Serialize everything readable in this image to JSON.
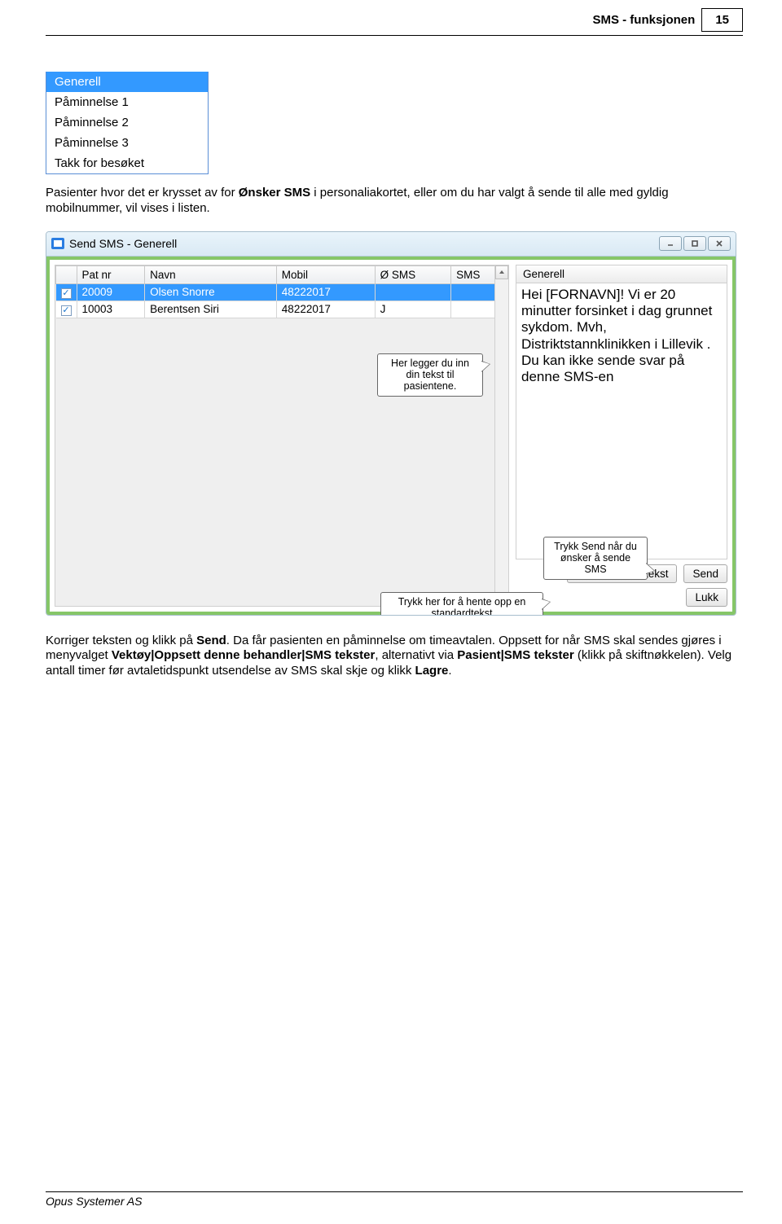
{
  "header": {
    "title": "SMS - funksjonen",
    "page": "15"
  },
  "dropdown": {
    "items": [
      "Generell",
      "Påminnelse 1",
      "Påminnelse 2",
      "Påminnelse 3",
      "Takk for besøket"
    ],
    "selected_index": 0
  },
  "para1": {
    "pre": "Pasienter hvor det er krysset av for ",
    "bold1": "Ønsker SMS",
    "post": " i personaliakortet, eller om du har valgt å sende til alle med gyldig mobilnummer, vil vises i listen."
  },
  "window": {
    "title": "Send SMS - Generell",
    "table": {
      "headers": [
        "",
        "Pat nr",
        "Navn",
        "Mobil",
        "Ø SMS",
        "SMS"
      ],
      "rows": [
        {
          "checked": true,
          "patnr": "20009",
          "navn": "Olsen Snorre",
          "mobil": "48222017",
          "osms": "",
          "sms": ""
        },
        {
          "checked": true,
          "patnr": "10003",
          "navn": "Berentsen Siri",
          "mobil": "48222017",
          "osms": "J",
          "sms": ""
        }
      ]
    },
    "template_name": "Generell",
    "template_text": "Hei [FORNAVN]! Vi er 20 minutter forsinket i dag grunnet sykdom. Mvh, Distriktstannklinikken i Lillevik . Du kan ikke sende svar på denne SMS-en",
    "buttons": {
      "hent": "Hent standardtekst",
      "send": "Send",
      "lukk": "Lukk"
    },
    "callouts": {
      "to_sms_col": "Her legger du inn din tekst til pasientene.",
      "to_send": "Trykk Send når du ønsker å sende SMS",
      "to_hent": "Trykk her for å hente opp en standardtekst"
    }
  },
  "para2": {
    "t1": "Korriger teksten og klikk på ",
    "b1": "Send",
    "t2": ". Da får pasienten en påminnelse om timeavtalen. Oppsett for når SMS skal sendes gjøres i menyvalget ",
    "b2": "Vektøy|Oppsett denne behandler|SMS tekster",
    "t3": ", alternativt via ",
    "b3": "Pasient|SMS tekster",
    "t4": " (klikk på skiftnøkkelen). Velg antall timer før avtaletidspunkt utsendelse av SMS skal skje og klikk ",
    "b4": "Lagre",
    "t5": "."
  },
  "footer": {
    "company": "Opus Systemer AS"
  }
}
